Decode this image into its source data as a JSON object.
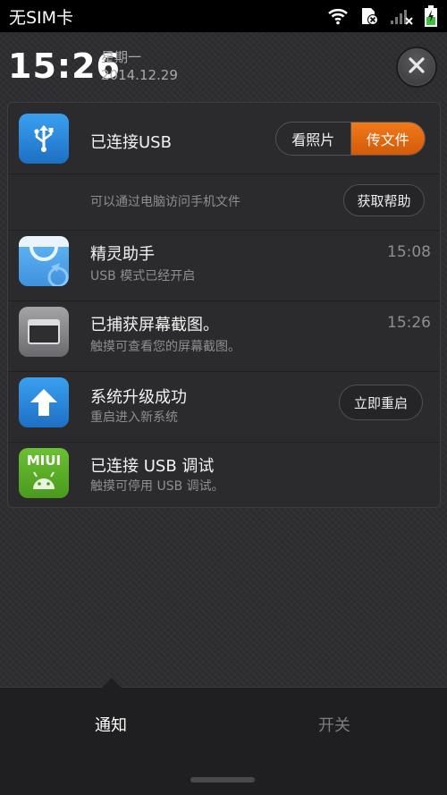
{
  "status_bar": {
    "carrier": "无SIM卡",
    "icons": [
      "wifi-icon",
      "no-sim-icon",
      "signal-icon",
      "battery-charging-icon"
    ]
  },
  "header": {
    "time": "15:26",
    "weekday": "星期一",
    "date": "2014.12.29",
    "close_icon": "close-icon"
  },
  "notifications": {
    "usb": {
      "title": "已连接USB",
      "toggle": {
        "left": "看照片",
        "right": "传文件",
        "selected": "传文件"
      },
      "help_text": "可以通过电脑访问手机文件",
      "help_button": "获取帮助",
      "icon": "usb-icon"
    },
    "items": [
      {
        "title": "精灵助手",
        "subtitle": "USB 模式已经开启",
        "time": "15:08",
        "icon": "shopping-bag-icon"
      },
      {
        "title": "已捕获屏幕截图。",
        "subtitle": "触摸可查看您的屏幕截图。",
        "time": "15:26",
        "icon": "screenshot-icon"
      },
      {
        "title": "系统升级成功",
        "subtitle": "重启进入新系统",
        "action": "立即重启",
        "icon": "upgrade-arrow-icon"
      },
      {
        "title": "已连接 USB 调试",
        "subtitle": "触摸可停用 USB 调试。",
        "icon": "miui-android-icon",
        "icon_label": "MIUI"
      }
    ]
  },
  "tabs": {
    "notify": "通知",
    "switches": "开关",
    "active": "通知"
  },
  "colors": {
    "accent_orange": "#e8680f",
    "usb_blue": "#2a8ae0",
    "miui_green": "#5aa829"
  }
}
